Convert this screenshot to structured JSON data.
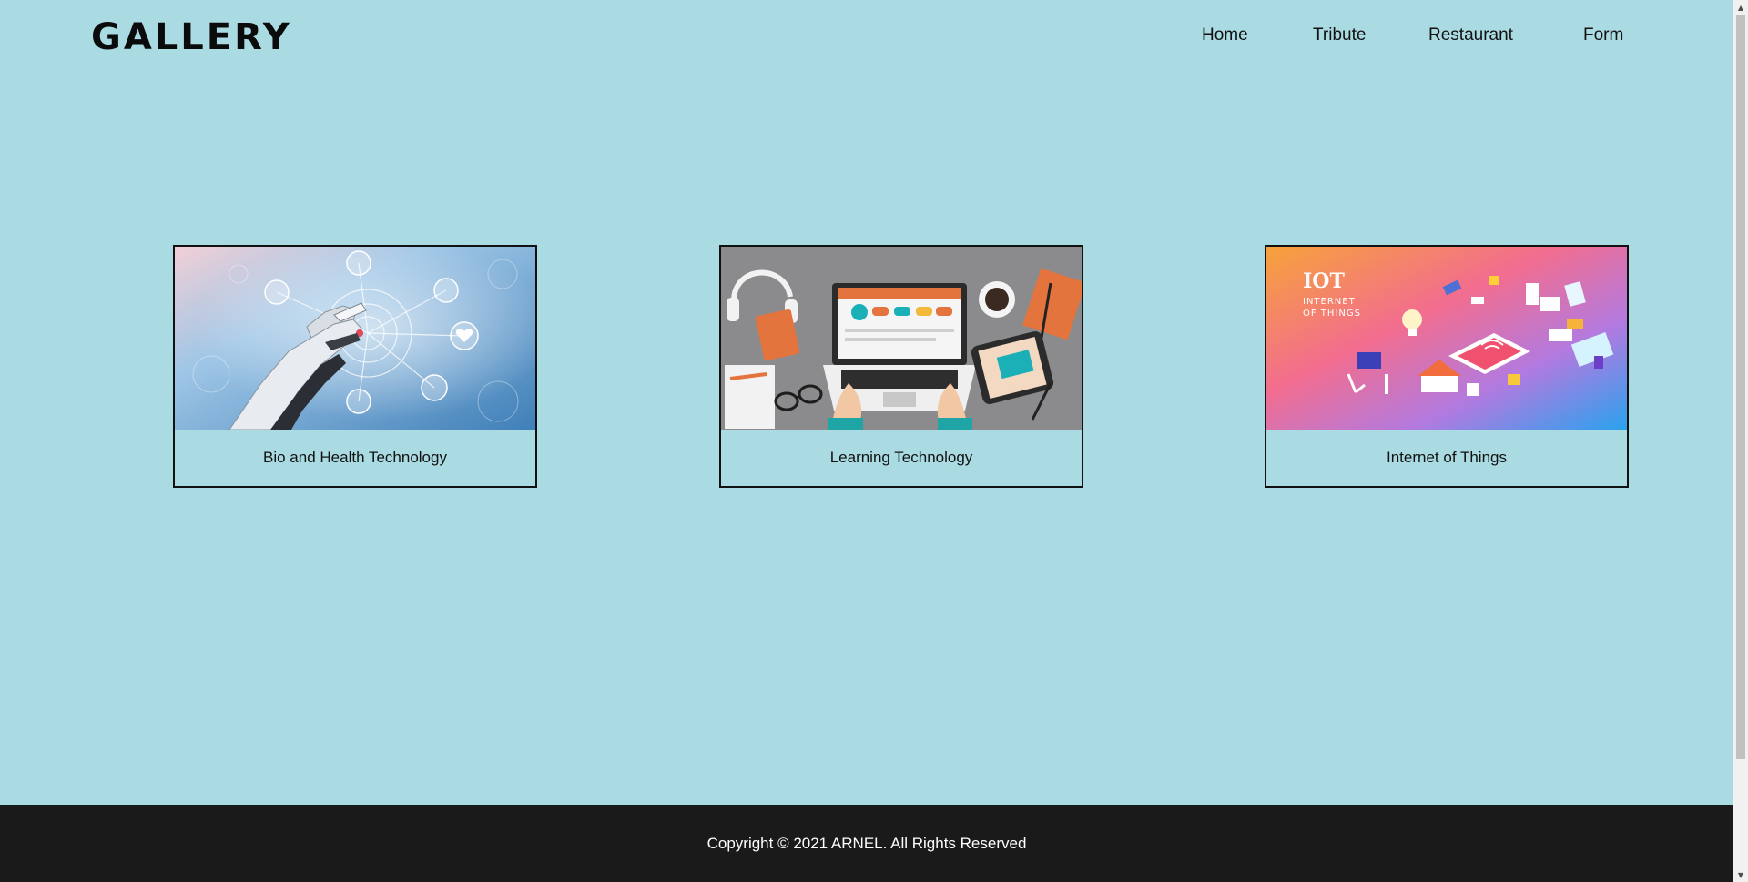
{
  "header": {
    "logo": "GALLERY",
    "nav": [
      {
        "label": "Home"
      },
      {
        "label": "Tribute"
      },
      {
        "label": "Restaurant"
      },
      {
        "label": "Form"
      }
    ]
  },
  "gallery": {
    "cards": [
      {
        "caption": "Bio and Health Technology",
        "image": "robot-hand-health-icons"
      },
      {
        "caption": "Learning Technology",
        "image": "laptop-desk-learning"
      },
      {
        "caption": "Internet of Things",
        "image": "iot-isometric",
        "image_text": [
          "IOT",
          "INTERNET",
          "OF THINGS"
        ]
      }
    ]
  },
  "footer": {
    "text": "Copyright © 2021 ARNEL. All Rights Reserved"
  },
  "colors": {
    "background": "#aadbe2",
    "footer_background": "#1a1a1b",
    "text": "#111111"
  }
}
